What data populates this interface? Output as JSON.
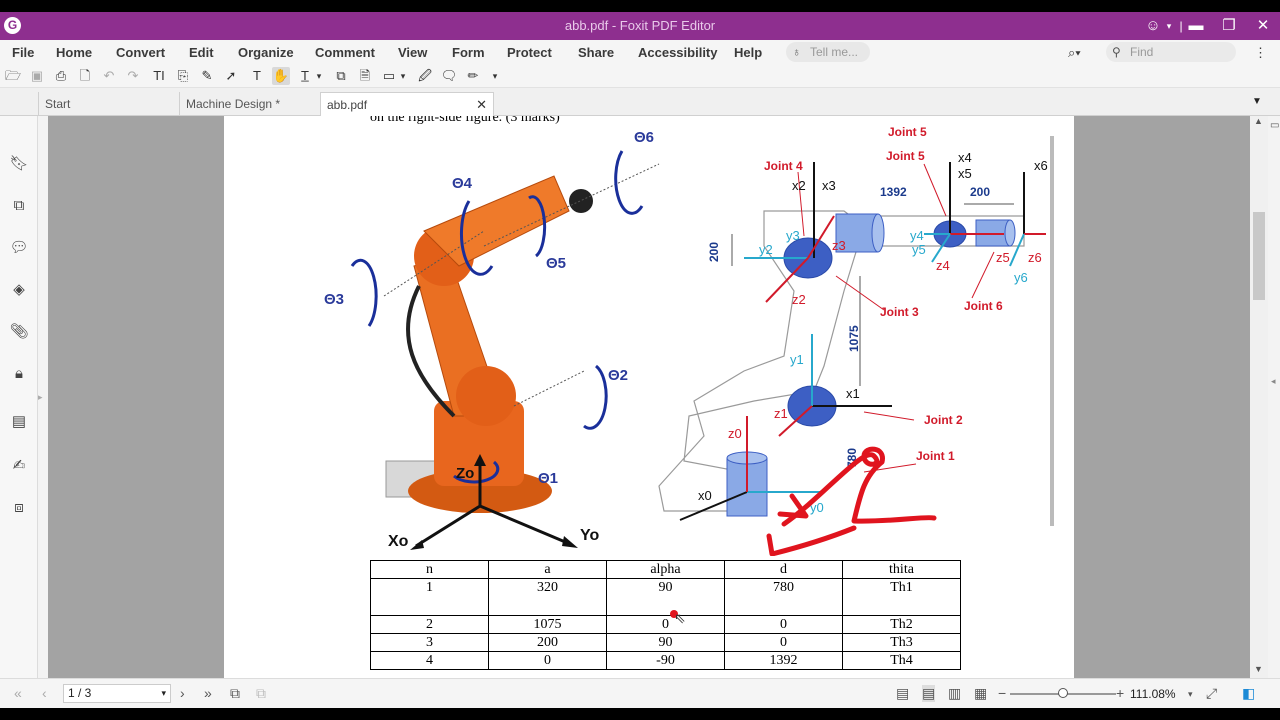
{
  "window": {
    "title": "abb.pdf - Foxit PDF Editor",
    "logo_letter": "G"
  },
  "menu": [
    "File",
    "Home",
    "Convert",
    "Edit",
    "Organize",
    "Comment",
    "View",
    "Form",
    "Protect",
    "Share",
    "Accessibility",
    "Help"
  ],
  "search": {
    "tell_me_placeholder": "Tell me...",
    "find_placeholder": "Find"
  },
  "tabs": [
    {
      "label": "Start"
    },
    {
      "label": "Machine Design *"
    },
    {
      "label": "abb.pdf"
    }
  ],
  "document": {
    "partial_line": "on the right-side figure. (3 marks)",
    "robot_labels": {
      "theta1": "Θ1",
      "theta2": "Θ2",
      "theta3": "Θ3",
      "theta4": "Θ4",
      "theta5": "Θ5",
      "theta6": "Θ6",
      "zo": "Zo",
      "xo": "Xo",
      "yo": "Yo"
    },
    "frame_labels": {
      "joint1": "Joint 1",
      "joint2": "Joint 2",
      "joint3": "Joint 3",
      "joint4": "Joint 4",
      "joint5a": "Joint 5",
      "joint5b": "Joint 5",
      "joint6": "Joint 6",
      "x0": "x0",
      "y0": "y0",
      "z0": "z0",
      "x1": "x1",
      "y1": "y1",
      "z1": "z1",
      "x2": "x2",
      "x3": "x3",
      "y2": "y2",
      "y3": "y3",
      "z2": "z2",
      "z3": "z3",
      "x4": "x4",
      "x5": "x5",
      "y4": "y4",
      "y5": "y5",
      "z4": "z4",
      "x6": "x6",
      "y6": "y6",
      "z5": "z5",
      "z6": "z6",
      "dim_1392": "1392",
      "dim_200_top": "200",
      "dim_200_left": "200",
      "dim_1075": "1075",
      "dim_780": "780"
    },
    "dh_table": {
      "headers": [
        "n",
        "a",
        "alpha",
        "d",
        "thita"
      ],
      "rows": [
        [
          "1",
          "320",
          "90",
          "780",
          "Th1"
        ],
        [
          "2",
          "1075",
          "0",
          "0",
          "Th2"
        ],
        [
          "3",
          "200",
          "90",
          "0",
          "Th3"
        ],
        [
          "4",
          "0",
          "-90",
          "1392",
          "Th4"
        ]
      ]
    }
  },
  "status": {
    "page_indicator": "1 / 3",
    "zoom": "111.08%"
  },
  "colors": {
    "titlebar": "#8e2f8f",
    "robot_orange": "#e8661e",
    "annotation_red": "#e0141e",
    "frame_red": "#d11a2a",
    "frame_cyan": "#27a8cc",
    "frame_blue": "#3d5fc4"
  }
}
